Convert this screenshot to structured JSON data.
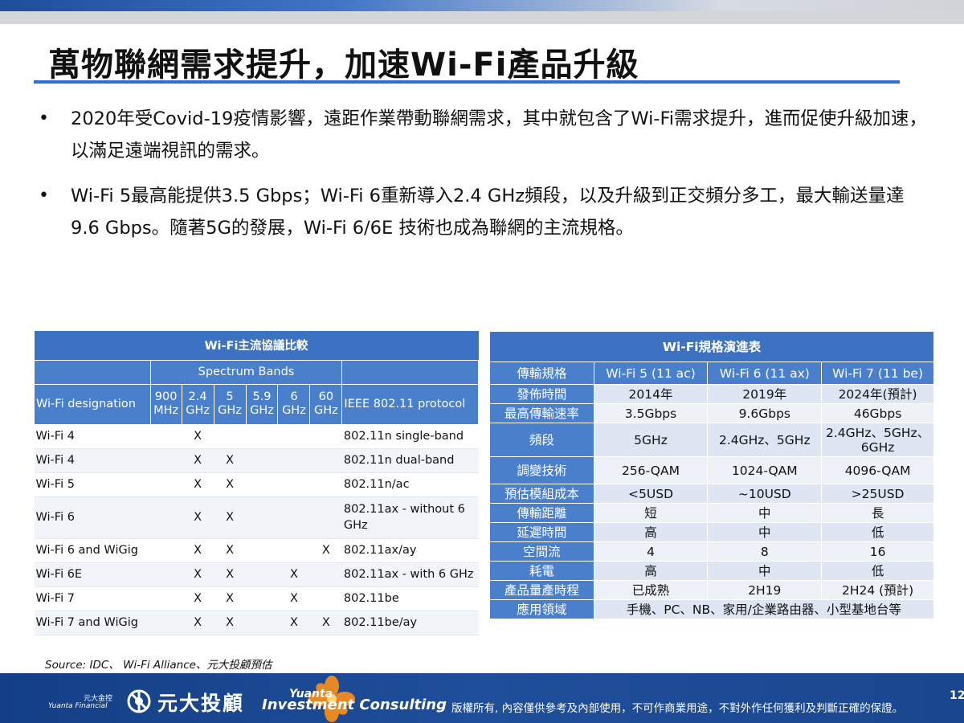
{
  "title": "萬物聯網需求提升，加速Wi-Fi產品升級",
  "bullets": [
    "2020年受Covid-19疫情影響，遠距作業帶動聯網需求，其中就包含了Wi-Fi需求提升，進而促使升級加速，以滿足遠端視訊的需求。",
    "Wi-Fi 5最高能提供3.5 Gbps；Wi-Fi 6重新導入2.4 GHz頻段，以及升級到正交頻分多工，最大輸送量達9.6 Gbps。隨著5G的發展，Wi-Fi 6/6E 技術也成為聯網的主流規格。"
  ],
  "protocol_table": {
    "title": "Wi-Fi主流協議比較",
    "spectrum_header": "Spectrum Bands",
    "designation_header": "Wi-Fi designation",
    "protocol_header": "IEEE 802.11 protocol",
    "bands": [
      "900 MHz",
      "2.4 GHz",
      "5 GHz",
      "5.9 GHz",
      "6 GHz",
      "60 GHz"
    ],
    "rows": [
      {
        "name": "Wi-Fi 4",
        "marks": [
          "",
          "X",
          "",
          "",
          "",
          ""
        ],
        "protocol": "802.11n single-band"
      },
      {
        "name": "Wi-Fi 4",
        "marks": [
          "",
          "X",
          "X",
          "",
          "",
          ""
        ],
        "protocol": "802.11n dual-band"
      },
      {
        "name": "Wi-Fi 5",
        "marks": [
          "",
          "X",
          "X",
          "",
          "",
          ""
        ],
        "protocol": "802.11n/ac"
      },
      {
        "name": "Wi-Fi 6",
        "marks": [
          "",
          "X",
          "X",
          "",
          "",
          ""
        ],
        "protocol": "802.11ax - without 6 GHz"
      },
      {
        "name": "Wi-Fi 6 and WiGig",
        "marks": [
          "",
          "X",
          "X",
          "",
          "",
          "X"
        ],
        "protocol": "802.11ax/ay"
      },
      {
        "name": "Wi-Fi 6E",
        "marks": [
          "",
          "X",
          "X",
          "",
          "X",
          ""
        ],
        "protocol": "802.11ax - with 6 GHz"
      },
      {
        "name": "Wi-Fi 7",
        "marks": [
          "",
          "X",
          "X",
          "",
          "X",
          ""
        ],
        "protocol": "802.11be"
      },
      {
        "name": "Wi-Fi 7 and WiGig",
        "marks": [
          "",
          "X",
          "X",
          "",
          "X",
          "X"
        ],
        "protocol": "802.11be/ay"
      }
    ]
  },
  "spec_table": {
    "title": "Wi-Fi規格演進表",
    "header": [
      "傳輸規格",
      "Wi-Fi 5 (11 ac)",
      "Wi-Fi 6 (11 ax)",
      "Wi-Fi 7 (11 be)"
    ],
    "rows": [
      {
        "label": "發佈時間",
        "values": [
          "2014年",
          "2019年",
          "2024年(預計)"
        ]
      },
      {
        "label": "最高傳輸速率",
        "values": [
          "3.5Gbps",
          "9.6Gbps",
          "46Gbps"
        ]
      },
      {
        "label": "頻段",
        "values": [
          "5GHz",
          "2.4GHz、5GHz",
          "2.4GHz、5GHz、6GHz"
        ]
      },
      {
        "label": "調變技術",
        "values": [
          "256-QAM",
          "1024-QAM",
          "4096-QAM"
        ]
      },
      {
        "label": "預估模組成本",
        "values": [
          "<5USD",
          "~10USD",
          ">25USD"
        ]
      },
      {
        "label": "傳輸距離",
        "values": [
          "短",
          "中",
          "長"
        ]
      },
      {
        "label": "延遲時間",
        "values": [
          "高",
          "中",
          "低"
        ]
      },
      {
        "label": "空間流",
        "values": [
          "4",
          "8",
          "16"
        ]
      },
      {
        "label": "耗電",
        "values": [
          "高",
          "中",
          "低"
        ]
      },
      {
        "label": "產品量產時程",
        "values": [
          "已成熟",
          "2H19",
          "2H24 (預計)"
        ]
      }
    ],
    "last_row": {
      "label": "應用領域",
      "value": "手機、PC、NB、家用/企業路由器、小型基地台等"
    }
  },
  "source": "Source: IDC、 Wi-Fi Alliance、元大投顧預估",
  "footer": {
    "yuanta_cn": "元大金控",
    "yuanta_en": "Yuanta Financial",
    "company": "元大投顧",
    "brand_top": "Yuanta",
    "brand": "Investment Consulting",
    "disclaimer": "版權所有, 內容僅供參考及內部使用，不可作商業用途，不對外作任何獲利及判斷正確的保證。",
    "page": "12"
  },
  "colors": {
    "header_blue": "#3d72c2",
    "cell_blue": "#4a7fcb",
    "rule_blue": "#2e6fd1",
    "footer_blue": "#1f4e9a",
    "flower_orange": "#f28c1e"
  }
}
